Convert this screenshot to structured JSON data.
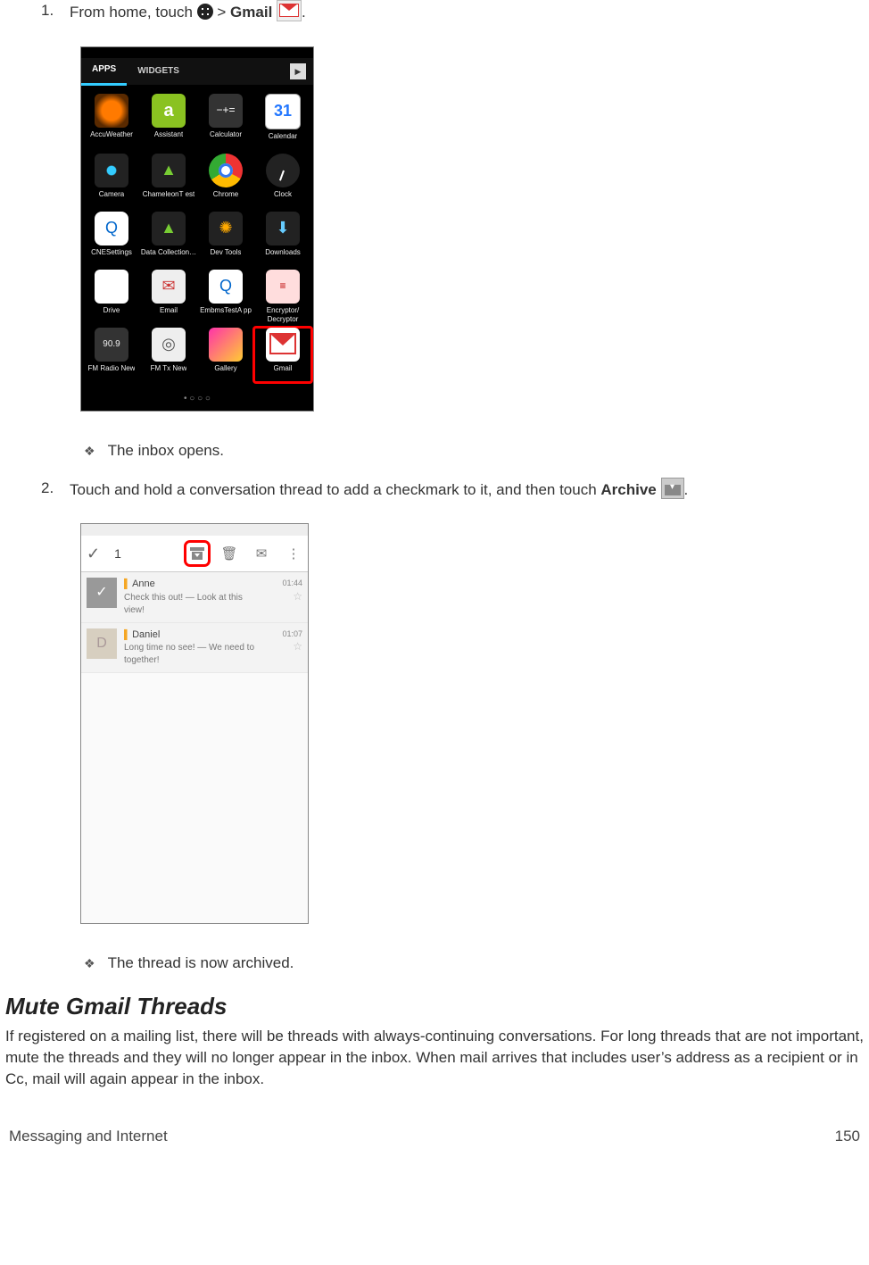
{
  "steps": {
    "s1": {
      "num": "1.",
      "text_before": "From home, touch ",
      "text_sep": " > ",
      "text_bold": "Gmail",
      "text_after": "."
    },
    "s1_bullet": "The inbox opens.",
    "s2": {
      "num": "2.",
      "text_before": "Touch and hold a conversation thread to add a checkmark to it, and then touch ",
      "text_bold": "Archive",
      "text_after": "."
    },
    "s2_bullet": "The thread is now archived."
  },
  "section": {
    "title": "Mute Gmail Threads",
    "body": "If registered on a mailing list, there will be threads with always-continuing conversations. For long threads that are not important, mute the threads and they will no longer appear in the inbox. When mail arrives that includes user’s address as a recipient or in Cc, mail will again appear in the inbox."
  },
  "footer": {
    "left": "Messaging and Internet",
    "right": "150"
  },
  "shot1": {
    "tab_apps": "APPS",
    "tab_widgets": "WIDGETS",
    "apps": [
      {
        "label": "AccuWeather",
        "cls": "ico-accu",
        "sym": ""
      },
      {
        "label": "Assistant",
        "cls": "ico-assist",
        "sym": "a"
      },
      {
        "label": "Calculator",
        "cls": "ico-calc",
        "sym": "−+="
      },
      {
        "label": "Calendar",
        "cls": "ico-cal",
        "sym": "31"
      },
      {
        "label": "Camera",
        "cls": "ico-cam",
        "sym": ""
      },
      {
        "label": "ChameleonT\nest",
        "cls": "ico-droid",
        "sym": "▲"
      },
      {
        "label": "Chrome",
        "cls": "ico-chrome",
        "sym": ""
      },
      {
        "label": "Clock",
        "cls": "ico-clock",
        "sym": ""
      },
      {
        "label": "CNESettings",
        "cls": "ico-cne",
        "sym": "Q"
      },
      {
        "label": "Data\nCollection…",
        "cls": "ico-data",
        "sym": "▲"
      },
      {
        "label": "Dev Tools",
        "cls": "ico-dev",
        "sym": "✺"
      },
      {
        "label": "Downloads",
        "cls": "ico-down",
        "sym": "⬇"
      },
      {
        "label": "Drive",
        "cls": "ico-drive",
        "sym": "▲"
      },
      {
        "label": "Email",
        "cls": "ico-email",
        "sym": "✉"
      },
      {
        "label": "EmbmsTestA\npp",
        "cls": "ico-em",
        "sym": "Q"
      },
      {
        "label": "Encryptor/\nDecryptor",
        "cls": "ico-enc",
        "sym": "≡"
      },
      {
        "label": "FM Radio\nNew",
        "cls": "ico-fm",
        "sym": "90.9"
      },
      {
        "label": "FM Tx New",
        "cls": "ico-fmtx",
        "sym": "◎"
      },
      {
        "label": "Gallery",
        "cls": "ico-gal",
        "sym": ""
      },
      {
        "label": "Gmail",
        "cls": "ico-gmail",
        "sym": "",
        "hl": true
      }
    ]
  },
  "shot2": {
    "count": "1",
    "rows": [
      {
        "avatar": "✓",
        "avatarCls": "sel",
        "flag": true,
        "sender": "Anne",
        "preview": "Check this out! — Look at this view!",
        "time": "01:44"
      },
      {
        "avatar": "D",
        "avatarCls": "d",
        "flag": true,
        "sender": "Daniel",
        "preview": "Long time no see! — We need to together!",
        "time": "01:07"
      }
    ]
  }
}
